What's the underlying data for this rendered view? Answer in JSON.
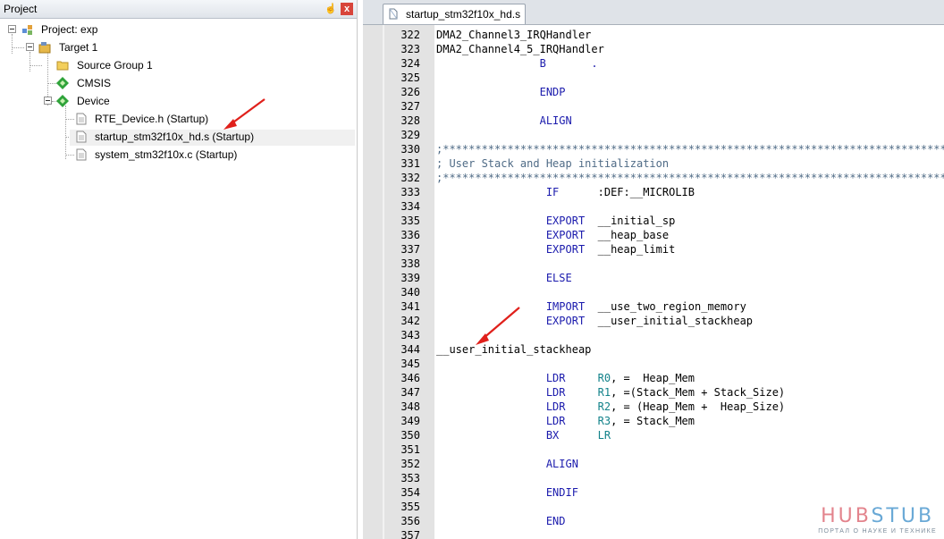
{
  "project_panel": {
    "title": "Project",
    "pin_symbol": "ᖐ",
    "close_symbol": "x",
    "tree": [
      {
        "label": "Project: exp",
        "icon": "project-icon"
      },
      {
        "label": "Target 1",
        "icon": "target-icon"
      },
      {
        "label": "Source Group 1",
        "icon": "folder-icon"
      },
      {
        "label": "CMSIS",
        "icon": "component-icon"
      },
      {
        "label": "Device",
        "icon": "component-icon"
      },
      {
        "label": "RTE_Device.h (Startup)",
        "icon": "file-icon"
      },
      {
        "label": "startup_stm32f10x_hd.s (Startup)",
        "icon": "file-icon",
        "selected": true
      },
      {
        "label": "system_stm32f10x.c (Startup)",
        "icon": "file-icon"
      }
    ]
  },
  "editor": {
    "tab_label": "startup_stm32f10x_hd.s",
    "line_numbers": [
      "322",
      "323",
      "324",
      "325",
      "326",
      "327",
      "328",
      "329",
      "330",
      "331",
      "332",
      "333",
      "334",
      "335",
      "336",
      "337",
      "338",
      "339",
      "340",
      "341",
      "342",
      "343",
      "344",
      "345",
      "346",
      "347",
      "348",
      "349",
      "350",
      "351",
      "352",
      "353",
      "354",
      "355",
      "356",
      "357"
    ],
    "lines": [
      [
        {
          "t": "DMA2_Channel3_IRQHandler",
          "c": "lab"
        }
      ],
      [
        {
          "t": "DMA2_Channel4_5_IRQHandler",
          "c": "lab"
        }
      ],
      [
        {
          "t": "                B       .",
          "c": "kw"
        }
      ],
      [],
      [
        {
          "t": "                ENDP",
          "c": "kw"
        }
      ],
      [],
      [
        {
          "t": "                ALIGN",
          "c": "kw"
        }
      ],
      [],
      [
        {
          "t": ";*******************************************************************************",
          "c": "cm"
        }
      ],
      [
        {
          "t": "; User Stack and Heap initialization",
          "c": "cm"
        }
      ],
      [
        {
          "t": ";*******************************************************************************",
          "c": "cm"
        }
      ],
      [
        {
          "t": "                 IF      ",
          "c": "kw"
        },
        {
          "t": ":DEF:__MICROLIB",
          "c": "lab"
        }
      ],
      [],
      [
        {
          "t": "                 EXPORT  ",
          "c": "kw"
        },
        {
          "t": "__initial_sp",
          "c": "lab"
        }
      ],
      [
        {
          "t": "                 EXPORT  ",
          "c": "kw"
        },
        {
          "t": "__heap_base",
          "c": "lab"
        }
      ],
      [
        {
          "t": "                 EXPORT  ",
          "c": "kw"
        },
        {
          "t": "__heap_limit",
          "c": "lab"
        }
      ],
      [],
      [
        {
          "t": "                 ELSE",
          "c": "kw"
        }
      ],
      [],
      [
        {
          "t": "                 IMPORT  ",
          "c": "kw"
        },
        {
          "t": "__use_two_region_memory",
          "c": "lab"
        }
      ],
      [
        {
          "t": "                 EXPORT  ",
          "c": "kw"
        },
        {
          "t": "__user_initial_stackheap",
          "c": "lab"
        }
      ],
      [],
      [
        {
          "t": "__user_initial_stackheap",
          "c": "lab"
        }
      ],
      [],
      [
        {
          "t": "                 LDR     ",
          "c": "kw"
        },
        {
          "t": "R0",
          "c": "gn"
        },
        {
          "t": ", =  Heap_Mem",
          "c": "lab"
        }
      ],
      [
        {
          "t": "                 LDR     ",
          "c": "kw"
        },
        {
          "t": "R1",
          "c": "gn"
        },
        {
          "t": ", =(Stack_Mem + Stack_Size)",
          "c": "lab"
        }
      ],
      [
        {
          "t": "                 LDR     ",
          "c": "kw"
        },
        {
          "t": "R2",
          "c": "gn"
        },
        {
          "t": ", = (Heap_Mem +  Heap_Size)",
          "c": "lab"
        }
      ],
      [
        {
          "t": "                 LDR     ",
          "c": "kw"
        },
        {
          "t": "R3",
          "c": "gn"
        },
        {
          "t": ", = Stack_Mem",
          "c": "lab"
        }
      ],
      [
        {
          "t": "                 BX      ",
          "c": "kw"
        },
        {
          "t": "LR",
          "c": "gn"
        }
      ],
      [],
      [
        {
          "t": "                 ALIGN",
          "c": "kw"
        }
      ],
      [],
      [
        {
          "t": "                 ENDIF",
          "c": "kw"
        }
      ],
      [],
      [
        {
          "t": "                 END",
          "c": "kw"
        }
      ],
      []
    ]
  },
  "watermark": {
    "hub": "HUB",
    "stub": "STUB",
    "tagline": "ПОРТАЛ О НАУКЕ И ТЕХНИКЕ"
  },
  "colors": {
    "keyword": "#1b1bad",
    "comment": "#4f6b86",
    "register": "#13828a",
    "annotation_arrow": "#e0201b"
  }
}
